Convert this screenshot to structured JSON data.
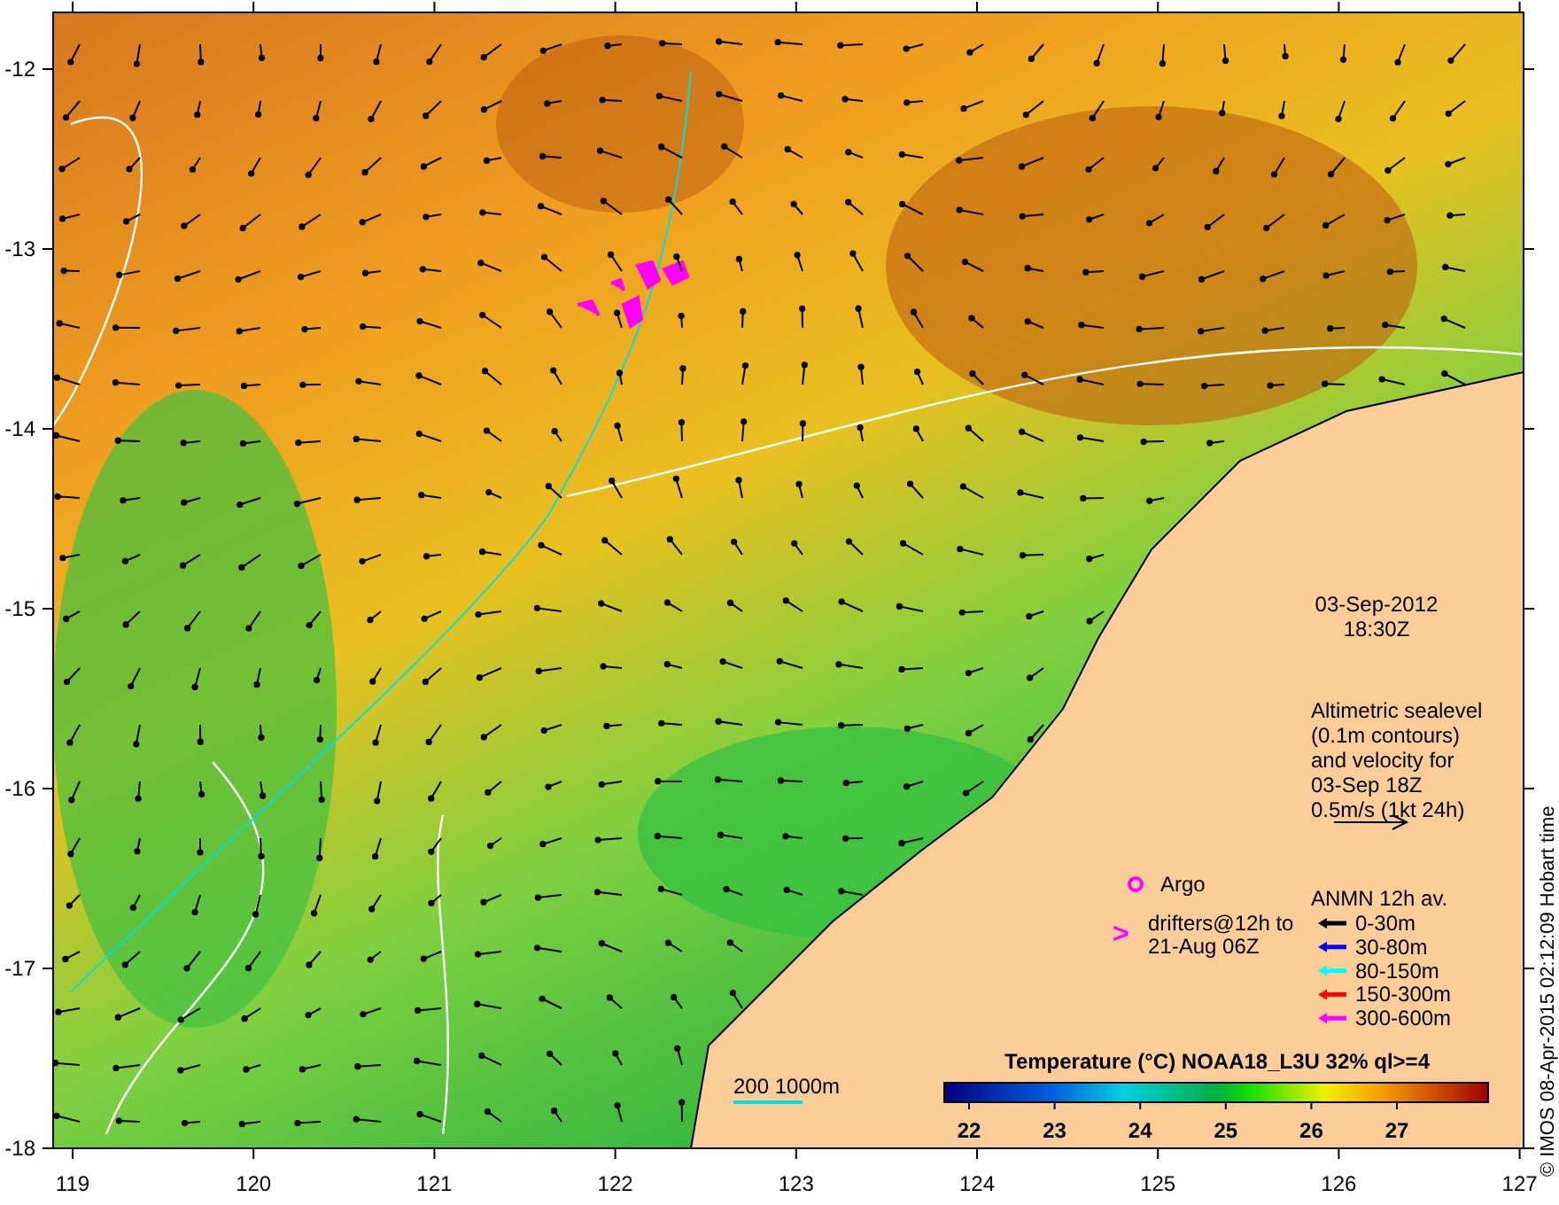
{
  "map": {
    "x_axis_labels": [
      "119",
      "120",
      "121",
      "122",
      "123",
      "124",
      "125",
      "126",
      "127"
    ],
    "y_axis_labels": [
      "-12",
      "-13",
      "-14",
      "-15",
      "-16",
      "-17",
      "-18"
    ],
    "date": "03-Sep-2012",
    "time": "18:30Z",
    "altimetry_note": [
      "Altimetric sealevel",
      "(0.1m contours)",
      "and velocity for",
      "03-Sep 18Z",
      "0.5m/s (1kt 24h)"
    ],
    "argo_label": "Argo",
    "drifters_marker": ">",
    "drifters_label": [
      "drifters@12h to",
      "21-Aug 06Z"
    ],
    "anmn_title": "ANMN 12h av.",
    "anmn_items": [
      {
        "label": "0-30m",
        "color": "#000000"
      },
      {
        "label": "30-80m",
        "color": "#0000ff"
      },
      {
        "label": "80-150m",
        "color": "#00ffff"
      },
      {
        "label": "150-300m",
        "color": "#ff0000"
      },
      {
        "label": "300-600m",
        "color": "#ff00ff"
      }
    ],
    "isobath_label": "200  1000m",
    "colorbar": {
      "title": "Temperature (°C) NOAA18_L3U 32% ql>=4",
      "labels": [
        "22",
        "23",
        "24",
        "25",
        "26",
        "27"
      ]
    },
    "credit": "© IMOS 08-Apr-2015 02:12:09 Hobart time"
  }
}
